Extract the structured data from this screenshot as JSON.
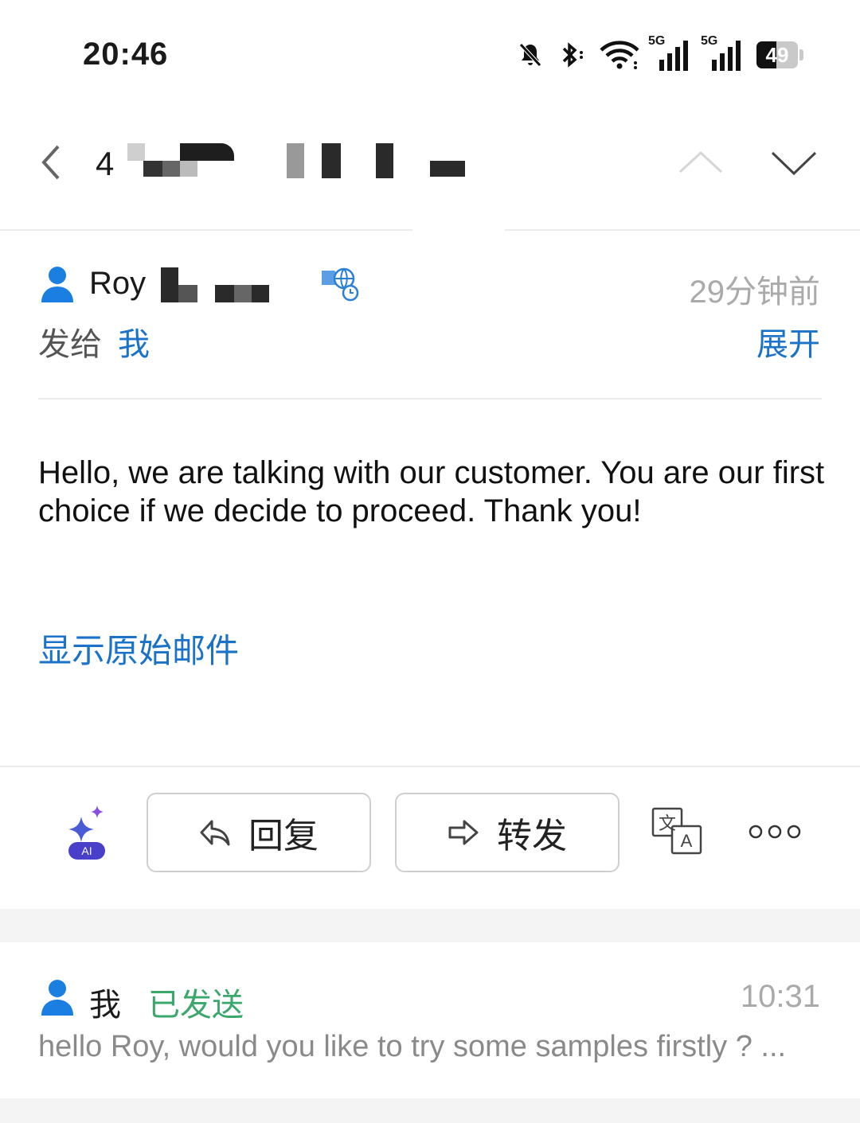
{
  "status_bar": {
    "time": "20:46",
    "network_1": "5G",
    "network_2": "5G",
    "battery": "49"
  },
  "header": {
    "subject_prefix": "4"
  },
  "message": {
    "sender_name": "Roy",
    "time_ago": "29分钟前",
    "to_label": "发给",
    "to_value": "我",
    "expand_label": "展开",
    "body": "Hello, we are talking with our customer. You are our first choice if we decide to proceed. Thank you!",
    "show_original": "显示原始邮件"
  },
  "actions": {
    "ai_label": "AI",
    "reply": "回复",
    "forward": "转发",
    "translate_src": "文",
    "translate_dst": "A"
  },
  "sent_item": {
    "sender": "我",
    "status": "已发送",
    "time": "10:31",
    "preview": "hello Roy,   would you like to try some samples firstly ?   ..."
  },
  "colors": {
    "link": "#1a73c9",
    "sent_status": "#3aa86b",
    "muted": "#aaaaaa",
    "person_icon": "#1a7fe0"
  }
}
